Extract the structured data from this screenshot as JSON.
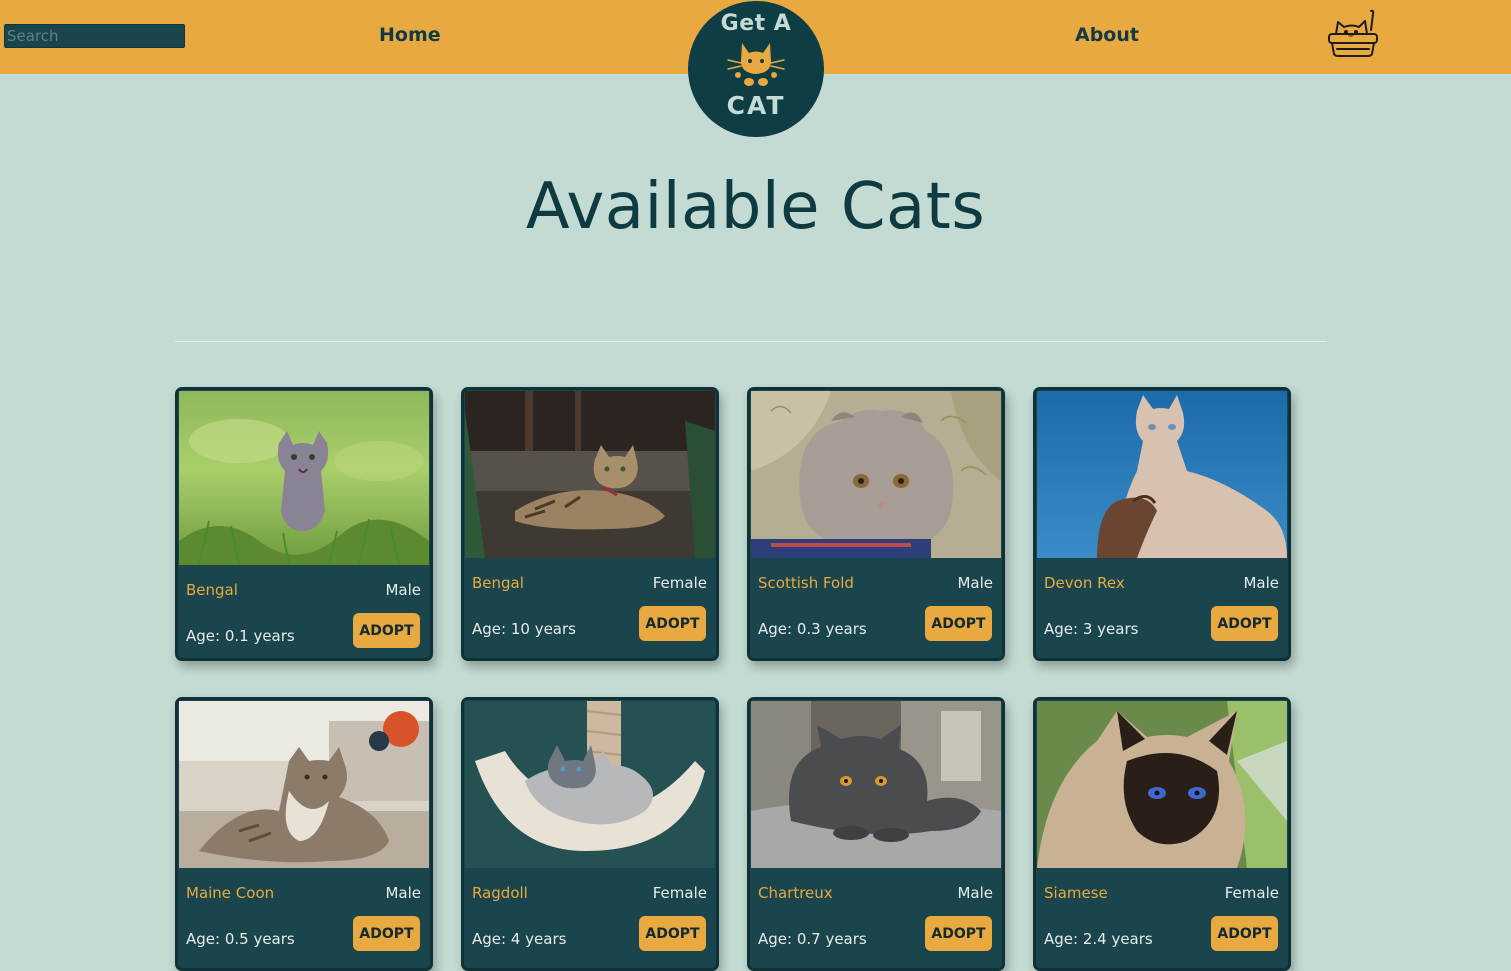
{
  "header": {
    "search_placeholder": "Search",
    "nav_home": "Home",
    "nav_about": "About",
    "logo_line1": "Get A",
    "logo_line2": "CAT",
    "cart_icon": "cat-in-basket-icon"
  },
  "main": {
    "title": "Available Cats"
  },
  "colors": {
    "background": "#c3dbd3",
    "navbar": "#e8a941",
    "card": "#1a454c",
    "accent": "#e8a941",
    "title": "#0e3a42"
  },
  "cats": [
    {
      "breed": "Bengal",
      "gender": "Male",
      "age": "Age: 0.1 years",
      "adopt": "ADOPT",
      "photo": "gray-kitten-in-grass"
    },
    {
      "breed": "Bengal",
      "gender": "Female",
      "age": "Age: 10 years",
      "adopt": "ADOPT",
      "photo": "bengal-cat-lying-outdoors"
    },
    {
      "breed": "Scottish Fold",
      "gender": "Male",
      "age": "Age: 0.3 years",
      "adopt": "ADOPT",
      "photo": "scottish-fold-kitten"
    },
    {
      "breed": "Devon Rex",
      "gender": "Male",
      "age": "Age: 3 years",
      "adopt": "ADOPT",
      "photo": "hairless-cat-blue-sky"
    },
    {
      "breed": "Maine Coon",
      "gender": "Male",
      "age": "Age: 0.5 years",
      "adopt": "ADOPT",
      "photo": "maine-coon-on-carpet"
    },
    {
      "breed": "Ragdoll",
      "gender": "Female",
      "age": "Age: 4 years",
      "adopt": "ADOPT",
      "photo": "ragdoll-in-hammock"
    },
    {
      "breed": "Chartreux",
      "gender": "Male",
      "age": "Age: 0.7 years",
      "adopt": "ADOPT",
      "photo": "gray-cat-on-sofa"
    },
    {
      "breed": "Siamese",
      "gender": "Female",
      "age": "Age: 2.4 years",
      "adopt": "ADOPT",
      "photo": "siamese-cat-portrait"
    }
  ]
}
